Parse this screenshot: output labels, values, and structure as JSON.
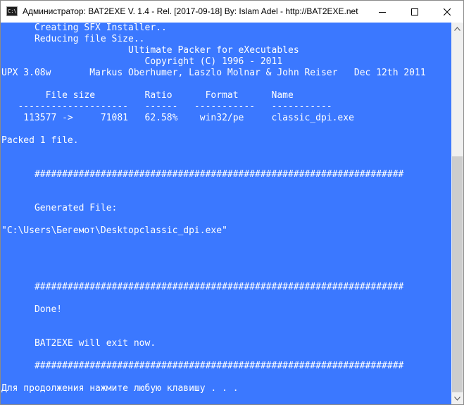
{
  "window": {
    "title": "Администратор:  BAT2EXE V. 1.4 - Rel. [2017-09-18] By: Islam Adel - http://BAT2EXE.net",
    "icon_label": "C:\\",
    "icon": "console-icon"
  },
  "controls": {
    "minimize_icon": "minimize-icon",
    "maximize_icon": "maximize-icon",
    "close_icon": "close-icon"
  },
  "console": {
    "background": "#3b78ff",
    "foreground": "#ffffff",
    "lines": [
      "      Creating SFX Installer..",
      "      Reducing file Size..",
      "                       Ultimate Packer for eXecutables",
      "                          Copyright (C) 1996 - 2011",
      "UPX 3.08w       Markus Oberhumer, Laszlo Molnar & John Reiser   Dec 12th 2011",
      "",
      "        File size         Ratio      Format      Name",
      "   --------------------   ------   -----------   -----------",
      "    113577 ->     71081   62.58%    win32/pe     classic_dpi.exe",
      "",
      "Packed 1 file.",
      "",
      "",
      "      ###################################################################",
      "",
      "",
      "      Generated File:",
      "",
      "\"C:\\Users\\Бегемот\\Desktopclassic_dpi.exe\"",
      "",
      "",
      "",
      "",
      "      ###################################################################",
      "",
      "      Done!",
      "",
      "",
      "      BAT2EXE will exit now.",
      "",
      "      ###################################################################",
      "",
      "Для продолжения нажмите любую клавишу . . ."
    ]
  },
  "scrollbar": {
    "up_icon": "scroll-up-arrow-icon",
    "down_icon": "scroll-down-arrow-icon"
  }
}
